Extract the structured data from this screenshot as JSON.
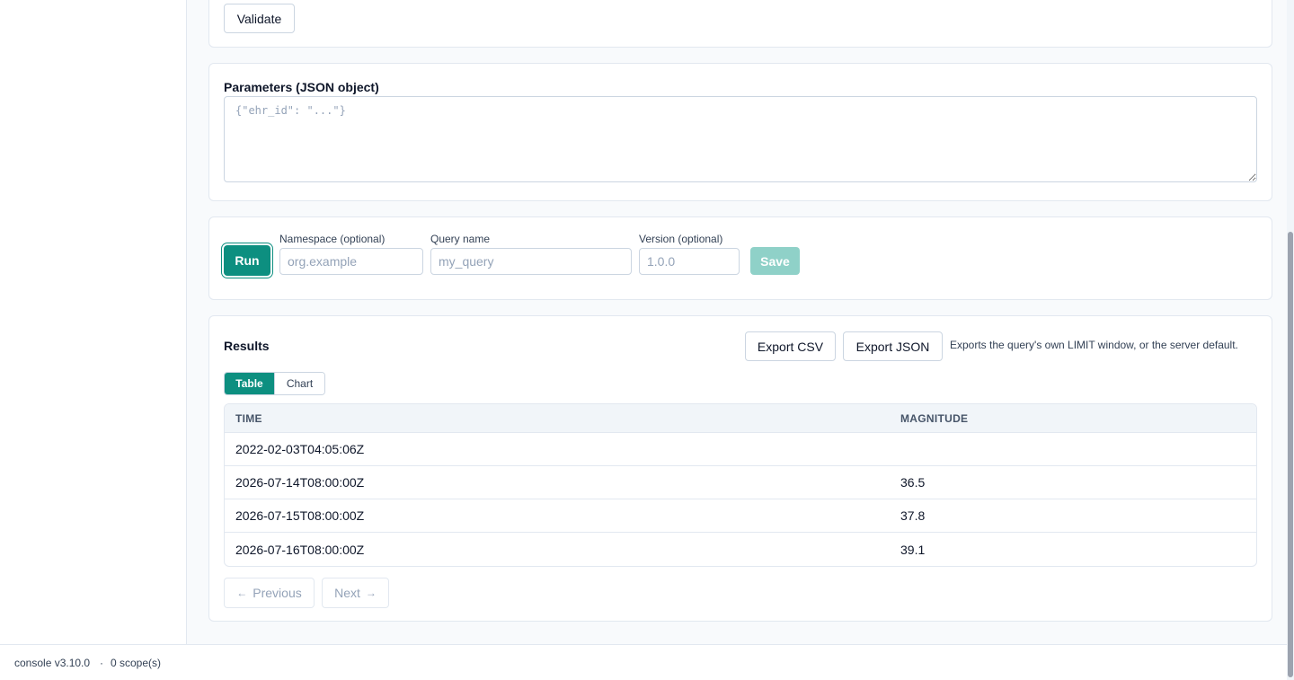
{
  "validate_label": "Validate",
  "params": {
    "label": "Parameters (JSON object)",
    "placeholder": "{\"ehr_id\": \"...\"}"
  },
  "run_bar": {
    "run_label": "Run",
    "namespace_label": "Namespace (optional)",
    "namespace_placeholder": "org.example",
    "query_name_label": "Query name",
    "query_name_placeholder": "my_query",
    "version_label": "Version (optional)",
    "version_placeholder": "1.0.0",
    "save_label": "Save"
  },
  "results": {
    "title": "Results",
    "export_csv": "Export CSV",
    "export_json": "Export JSON",
    "export_note": "Exports the query's own LIMIT window, or the server default.",
    "tabs": [
      {
        "label": "Table",
        "active": true
      },
      {
        "label": "Chart",
        "active": false
      }
    ],
    "columns": [
      "TIME",
      "MAGNITUDE"
    ],
    "rows": [
      [
        "2022-02-03T04:05:06Z",
        ""
      ],
      [
        "2026-07-14T08:00:00Z",
        "36.5"
      ],
      [
        "2026-07-15T08:00:00Z",
        "37.8"
      ],
      [
        "2026-07-16T08:00:00Z",
        "39.1"
      ]
    ],
    "previous_label": "Previous",
    "next_label": "Next"
  },
  "footer": {
    "version": "console v3.10.0",
    "separator": "·",
    "scopes": "0 scope(s)"
  },
  "colors": {
    "accent": "#0d8f80",
    "accent_disabled": "#8fd1c8"
  }
}
